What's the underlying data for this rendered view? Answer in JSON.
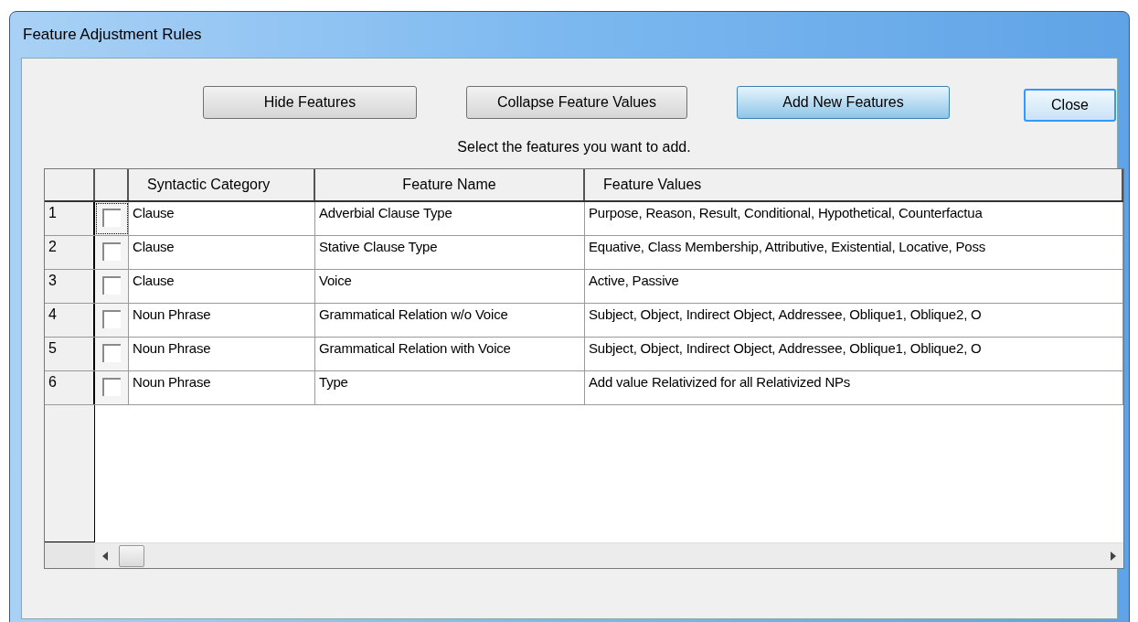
{
  "window": {
    "title": "Feature Adjustment Rules"
  },
  "buttons": [
    {
      "label": "Hide Features",
      "kind": "plain"
    },
    {
      "label": "Collapse Feature Values",
      "kind": "plain"
    },
    {
      "label": "Add New Features",
      "kind": "hot"
    },
    {
      "label": "Close",
      "kind": "focused"
    }
  ],
  "instruction": "Select the features you want to add.",
  "table": {
    "columns": [
      "Syntactic Category",
      "Feature Name",
      "Feature Values"
    ],
    "rows": [
      {
        "number": "1",
        "checked": false,
        "focused": true,
        "cells": [
          "Clause",
          "Adverbial Clause Type",
          "Purpose, Reason, Result, Conditional, Hypothetical, Counterfactua"
        ]
      },
      {
        "number": "2",
        "checked": false,
        "focused": false,
        "cells": [
          "Clause",
          "Stative Clause Type",
          "Equative, Class Membership, Attributive, Existential, Locative, Poss"
        ]
      },
      {
        "number": "3",
        "checked": false,
        "focused": false,
        "cells": [
          "Clause",
          "Voice",
          "Active, Passive"
        ]
      },
      {
        "number": "4",
        "checked": false,
        "focused": false,
        "cells": [
          "Noun Phrase",
          "Grammatical Relation w/o Voice",
          "Subject, Object, Indirect Object, Addressee, Oblique1, Oblique2, O"
        ]
      },
      {
        "number": "5",
        "checked": false,
        "focused": false,
        "cells": [
          "Noun Phrase",
          "Grammatical Relation with Voice",
          "Subject, Object, Indirect Object, Addressee, Oblique1, Oblique2, O"
        ]
      },
      {
        "number": "6",
        "checked": false,
        "focused": false,
        "cells": [
          "Noun Phrase",
          "Type",
          "Add value Relativized for all Relativized NPs"
        ]
      }
    ]
  }
}
